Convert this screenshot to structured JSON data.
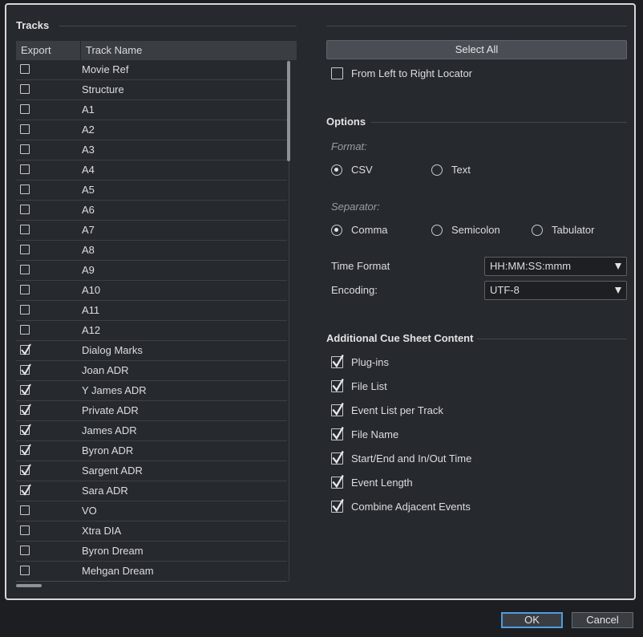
{
  "tracks": {
    "title": "Tracks",
    "col_export": "Export",
    "col_name": "Track Name",
    "rows": [
      {
        "name": "Movie Ref",
        "checked": false
      },
      {
        "name": "Structure",
        "checked": false
      },
      {
        "name": "A1",
        "checked": false
      },
      {
        "name": "A2",
        "checked": false
      },
      {
        "name": "A3",
        "checked": false
      },
      {
        "name": "A4",
        "checked": false
      },
      {
        "name": "A5",
        "checked": false
      },
      {
        "name": "A6",
        "checked": false
      },
      {
        "name": "A7",
        "checked": false
      },
      {
        "name": "A8",
        "checked": false
      },
      {
        "name": "A9",
        "checked": false
      },
      {
        "name": "A10",
        "checked": false
      },
      {
        "name": "A11",
        "checked": false
      },
      {
        "name": "A12",
        "checked": false
      },
      {
        "name": "Dialog Marks",
        "checked": true
      },
      {
        "name": "Joan ADR",
        "checked": true
      },
      {
        "name": "Y James ADR",
        "checked": true
      },
      {
        "name": "Private ADR",
        "checked": true
      },
      {
        "name": "James ADR",
        "checked": true
      },
      {
        "name": "Byron ADR",
        "checked": true
      },
      {
        "name": "Sargent ADR",
        "checked": true
      },
      {
        "name": "Sara ADR",
        "checked": true
      },
      {
        "name": "VO",
        "checked": false
      },
      {
        "name": "Xtra DIA",
        "checked": false
      },
      {
        "name": "Byron Dream",
        "checked": false
      },
      {
        "name": "Mehgan Dream",
        "checked": false
      }
    ]
  },
  "range": {
    "select_all": "Select All",
    "locator_label": "From Left to Right Locator",
    "locator_checked": false
  },
  "options": {
    "title": "Options",
    "format_label": "Format:",
    "format_choices": [
      "CSV",
      "Text"
    ],
    "format_selected": "CSV",
    "separator_label": "Separator:",
    "separator_choices": [
      "Comma",
      "Semicolon",
      "Tabulator"
    ],
    "separator_selected": "Comma",
    "time_format_label": "Time Format",
    "time_format_value": "HH:MM:SS:mmm",
    "encoding_label": "Encoding:",
    "encoding_value": "UTF-8"
  },
  "content": {
    "title": "Additional Cue Sheet Content",
    "items": [
      {
        "label": "Plug-ins",
        "checked": true
      },
      {
        "label": "File List",
        "checked": true
      },
      {
        "label": "Event List per Track",
        "checked": true
      },
      {
        "label": "File Name",
        "checked": true
      },
      {
        "label": "Start/End and In/Out Time",
        "checked": true
      },
      {
        "label": "Event Length",
        "checked": true
      },
      {
        "label": "Combine Adjacent Events",
        "checked": true
      }
    ]
  },
  "footer": {
    "ok": "OK",
    "cancel": "Cancel"
  },
  "colors": {
    "focus_accent": "#4f9be0",
    "background": "#26292d"
  }
}
